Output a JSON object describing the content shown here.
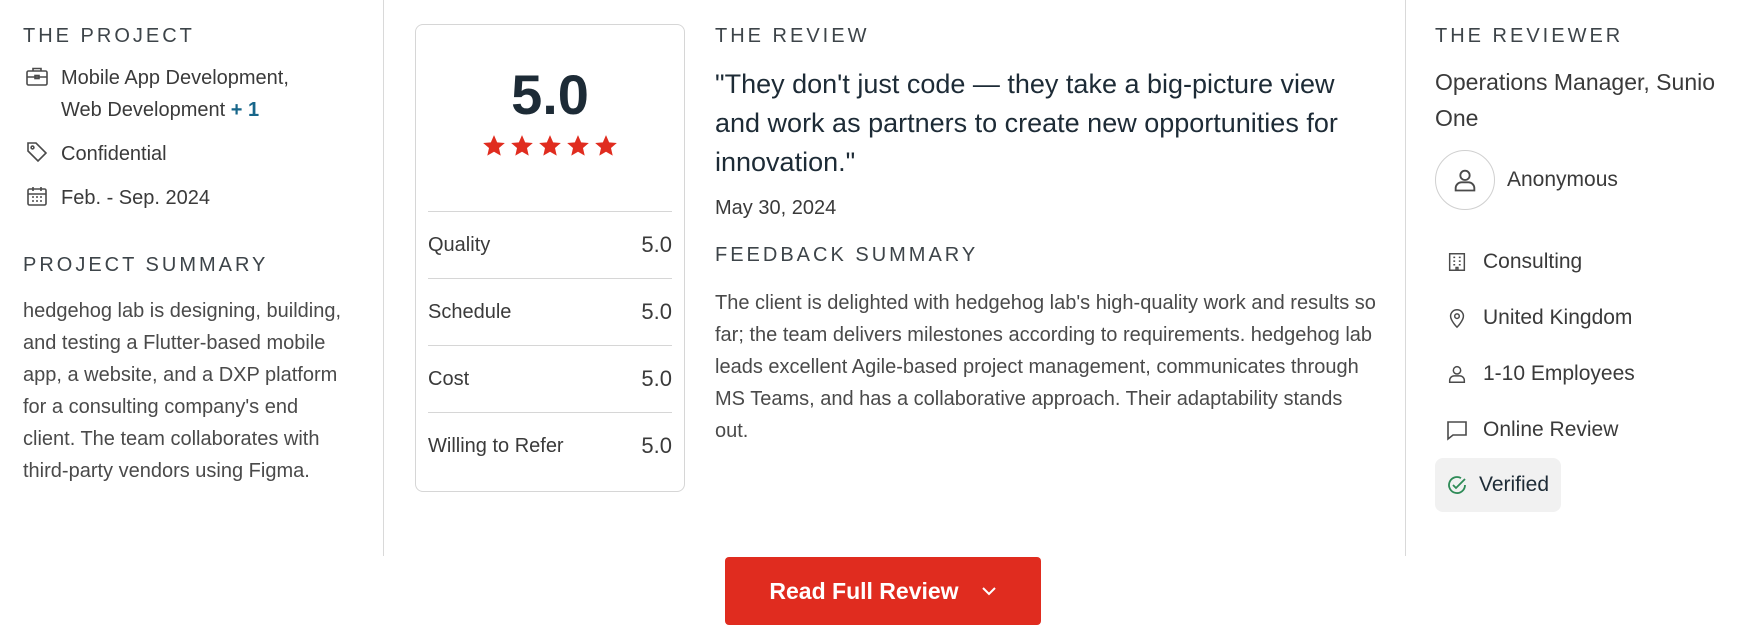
{
  "project": {
    "heading": "THE PROJECT",
    "services_line1": "Mobile App Development,",
    "services_line2": "Web Development",
    "services_more": "+ 1",
    "budget": "Confidential",
    "dates": "Feb. - Sep. 2024",
    "summary_heading": "PROJECT SUMMARY",
    "summary": "hedgehog lab is designing, building, and testing a Flutter-based mobile app, a website, and a DXP platform for a consulting company's end client. The team collaborates with third-party vendors using Figma."
  },
  "rating": {
    "overall": "5.0",
    "stars": 5,
    "star_color": "#e02c1f",
    "rows": [
      {
        "label": "Quality",
        "value": "5.0"
      },
      {
        "label": "Schedule",
        "value": "5.0"
      },
      {
        "label": "Cost",
        "value": "5.0"
      },
      {
        "label": "Willing to Refer",
        "value": "5.0"
      }
    ]
  },
  "review": {
    "heading": "THE REVIEW",
    "quote": "\"They don't just code — they take a big-picture view and work as partners to create new opportunities for innovation.\"",
    "date": "May 30, 2024",
    "feedback_heading": "FEEDBACK SUMMARY",
    "feedback": "The client is delighted with hedgehog lab's high-quality work and results so far; the team delivers milestones according to requirements. hedgehog lab leads excellent Agile-based project management, communicates through MS Teams, and has a collaborative approach. Their adaptability stands out."
  },
  "reviewer": {
    "heading": "THE REVIEWER",
    "role": "Operations Manager, Sunio One",
    "name": "Anonymous",
    "industry": "Consulting",
    "location": "United Kingdom",
    "size": "1-10 Employees",
    "review_type": "Online Review",
    "verified": "Verified",
    "verified_color": "#2e8b57"
  },
  "actions": {
    "read_full_review": "Read Full Review"
  }
}
